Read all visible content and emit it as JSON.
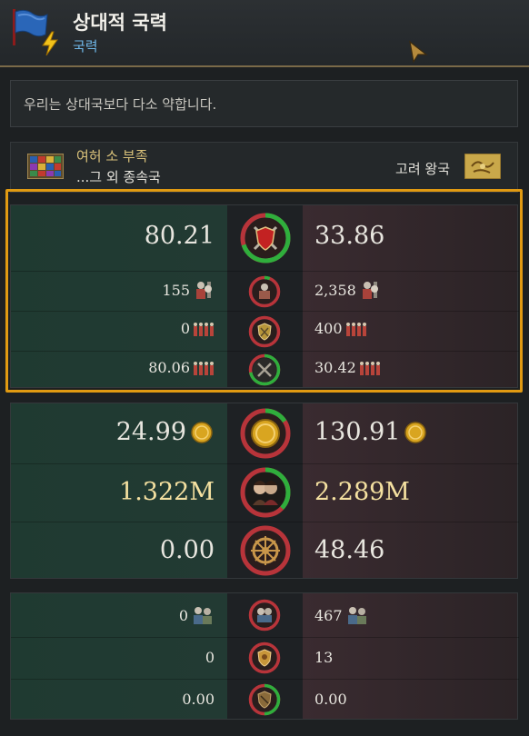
{
  "header": {
    "title": "상대적 국력",
    "subtitle": "국력"
  },
  "description": "우리는 상대국보다 다소 약합니다.",
  "sides": {
    "left_name_line1": "여허 소 부족",
    "left_name_line2": "...그 외 종속국",
    "right_name": "고려 왕국"
  },
  "military": {
    "main": {
      "left": "80.21",
      "right": "33.86",
      "ratio_left": 0.7
    },
    "rows": [
      {
        "left": "155",
        "right": "2,358",
        "icon": "soldier-icon",
        "ratio_left": 0.06
      },
      {
        "left": "0",
        "right": "400",
        "icon": "regiment-icon",
        "ratio_left": 0.0
      },
      {
        "left": "80.06",
        "right": "30.42",
        "icon": "regiment-icon",
        "ratio_left": 0.72
      }
    ]
  },
  "economy": {
    "rows": [
      {
        "left": "24.99",
        "right": "130.91",
        "icon": "gold-coin-icon",
        "ratio_left": 0.16
      },
      {
        "left": "1.322M",
        "right": "2.289M",
        "icon": "population-icon",
        "ratio_left": 0.37
      },
      {
        "left": "0.00",
        "right": "48.46",
        "icon": "ship-wheel-icon",
        "ratio_left": 0.0
      }
    ]
  },
  "characters": {
    "rows": [
      {
        "left": "0",
        "right": "467",
        "icon": "knights-icon",
        "ratio_left": 0.0
      },
      {
        "left": "0",
        "right": "13",
        "icon": "shield-icon",
        "ratio_left": 0.0
      },
      {
        "left": "0.00",
        "right": "0.00",
        "icon": "shield-icon",
        "ratio_left": 0.5
      }
    ]
  },
  "colors": {
    "accent": "#e09a12",
    "ring_green": "#2fae3c",
    "ring_red": "#b8343a",
    "subtitle": "#6fb6e6"
  }
}
